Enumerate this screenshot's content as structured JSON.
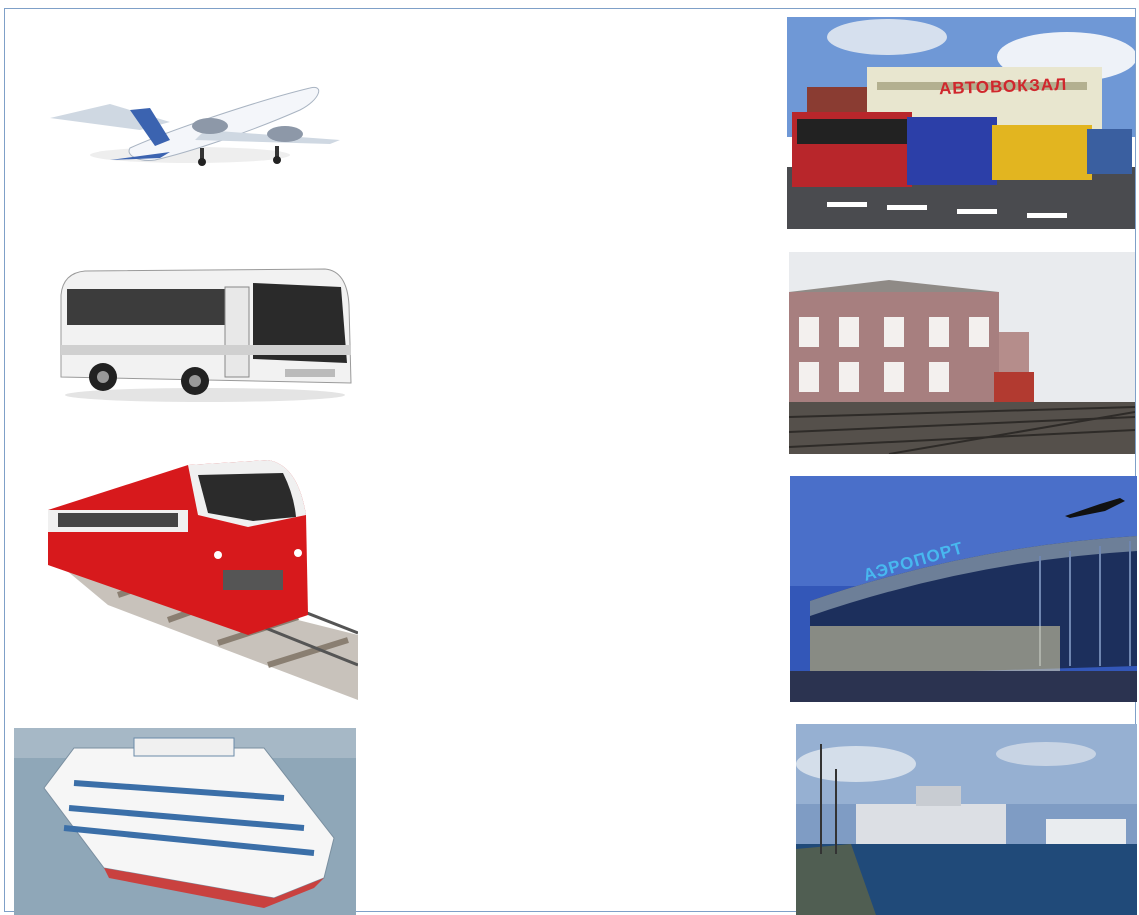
{
  "images": {
    "transport": [
      "airplane",
      "bus",
      "train",
      "ship"
    ],
    "stations": [
      "bus-station",
      "railway-station",
      "airport",
      "river-port"
    ]
  },
  "signs": {
    "bus_station": "АВТОВОКЗАЛ",
    "airport": "АЭРОПОРТ"
  }
}
